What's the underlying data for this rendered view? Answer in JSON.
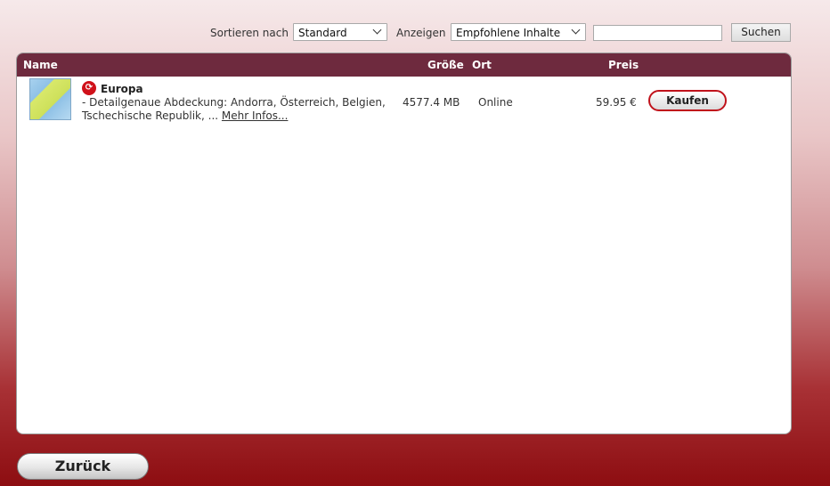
{
  "toolbar": {
    "sort_label": "Sortieren nach",
    "sort_value": "Standard",
    "show_label": "Anzeigen",
    "show_value": "Empfohlene Inhalte",
    "search_value": "",
    "search_button": "Suchen"
  },
  "table": {
    "columns": {
      "name": "Name",
      "size": "Größe",
      "location": "Ort",
      "price": "Preis"
    },
    "rows": [
      {
        "title": "Europa",
        "description": "- Detailgenaue Abdeckung: Andorra, Österreich, Belgien, Tschechische Republik, ...",
        "more_link": "Mehr Infos...",
        "size": "4577.4 MB",
        "location": "Online",
        "price": "59.95 €",
        "buy_label": "Kaufen"
      }
    ]
  },
  "footer": {
    "back_label": "Zurück"
  },
  "colors": {
    "header_bg": "#6e2a3e",
    "accent_red": "#c0121b",
    "page_bottom": "#8d0d11"
  }
}
